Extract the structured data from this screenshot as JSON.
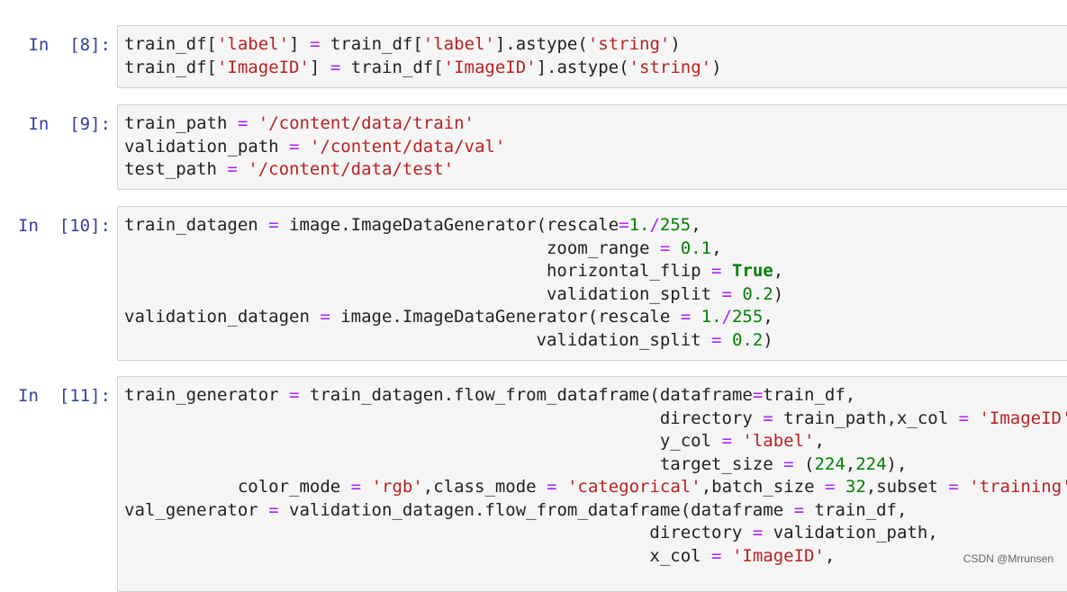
{
  "colors": {
    "prompt": "#303f9f",
    "default": "#212121",
    "operator": "#aa22ff",
    "string": "#ba2121",
    "number": "#008000",
    "keyword": "#008000",
    "cell_background": "#f5f5f5",
    "cell_border": "#cfcfcf"
  },
  "watermark": "CSDN @Mrrunsen",
  "cells": [
    {
      "prompt": "In  [8]:",
      "lines": [
        [
          [
            "var",
            "train_df"
          ],
          [
            "p",
            "["
          ],
          [
            "s",
            "'label'"
          ],
          [
            "p",
            "] "
          ],
          [
            "o",
            "="
          ],
          [
            "p",
            " train_df["
          ],
          [
            "s",
            "'label'"
          ],
          [
            "p",
            "].astype("
          ],
          [
            "s",
            "'string'"
          ],
          [
            "p",
            ")"
          ]
        ],
        [
          [
            "var",
            "train_df"
          ],
          [
            "p",
            "["
          ],
          [
            "s",
            "'ImageID'"
          ],
          [
            "p",
            "] "
          ],
          [
            "o",
            "="
          ],
          [
            "p",
            " train_df["
          ],
          [
            "s",
            "'ImageID'"
          ],
          [
            "p",
            "].astype("
          ],
          [
            "s",
            "'string'"
          ],
          [
            "p",
            ")"
          ]
        ]
      ]
    },
    {
      "prompt": "In  [9]:",
      "lines": [
        [
          [
            "var",
            "train_path "
          ],
          [
            "o",
            "="
          ],
          [
            "p",
            " "
          ],
          [
            "s",
            "'/content/data/train'"
          ]
        ],
        [
          [
            "var",
            "validation_path "
          ],
          [
            "o",
            "="
          ],
          [
            "p",
            " "
          ],
          [
            "s",
            "'/content/data/val'"
          ]
        ],
        [
          [
            "var",
            "test_path "
          ],
          [
            "o",
            "="
          ],
          [
            "p",
            " "
          ],
          [
            "s",
            "'/content/data/test'"
          ]
        ]
      ]
    },
    {
      "prompt": "In  [10]:",
      "lines": [
        [
          [
            "var",
            "train_datagen "
          ],
          [
            "o",
            "="
          ],
          [
            "p",
            " image.ImageDataGenerator(rescale"
          ],
          [
            "o",
            "="
          ],
          [
            "n",
            "1."
          ],
          [
            "o",
            "/"
          ],
          [
            "n",
            "255"
          ],
          [
            "p",
            ","
          ]
        ],
        [
          [
            "p",
            "                                         zoom_range "
          ],
          [
            "o",
            "="
          ],
          [
            "p",
            " "
          ],
          [
            "n",
            "0.1"
          ],
          [
            "p",
            ","
          ]
        ],
        [
          [
            "p",
            "                                         horizontal_flip "
          ],
          [
            "o",
            "="
          ],
          [
            "p",
            " "
          ],
          [
            "k",
            "True"
          ],
          [
            "p",
            ","
          ]
        ],
        [
          [
            "p",
            "                                         validation_split "
          ],
          [
            "o",
            "="
          ],
          [
            "p",
            " "
          ],
          [
            "n",
            "0.2"
          ],
          [
            "p",
            ")"
          ]
        ],
        [
          [
            "var",
            "validation_datagen "
          ],
          [
            "o",
            "="
          ],
          [
            "p",
            " image.ImageDataGenerator(rescale "
          ],
          [
            "o",
            "="
          ],
          [
            "p",
            " "
          ],
          [
            "n",
            "1."
          ],
          [
            "o",
            "/"
          ],
          [
            "n",
            "255"
          ],
          [
            "p",
            ","
          ]
        ],
        [
          [
            "p",
            "                                        validation_split "
          ],
          [
            "o",
            "="
          ],
          [
            "p",
            " "
          ],
          [
            "n",
            "0.2"
          ],
          [
            "p",
            ")"
          ]
        ]
      ]
    },
    {
      "prompt": "In  [11]:",
      "lines": [
        [
          [
            "var",
            "train_generator "
          ],
          [
            "o",
            "="
          ],
          [
            "p",
            " train_datagen.flow_from_dataframe(dataframe"
          ],
          [
            "o",
            "="
          ],
          [
            "p",
            "train_df,"
          ]
        ],
        [
          [
            "p",
            "                                                    directory "
          ],
          [
            "o",
            "="
          ],
          [
            "p",
            " train_path,x_col "
          ],
          [
            "o",
            "="
          ],
          [
            "p",
            " "
          ],
          [
            "s",
            "'ImageID'"
          ],
          [
            "p",
            ","
          ]
        ],
        [
          [
            "p",
            "                                                    y_col "
          ],
          [
            "o",
            "="
          ],
          [
            "p",
            " "
          ],
          [
            "s",
            "'label'"
          ],
          [
            "p",
            ","
          ]
        ],
        [
          [
            "p",
            "                                                    target_size "
          ],
          [
            "o",
            "="
          ],
          [
            "p",
            " ("
          ],
          [
            "n",
            "224"
          ],
          [
            "p",
            ","
          ],
          [
            "n",
            "224"
          ],
          [
            "p",
            "),"
          ]
        ],
        [
          [
            "p",
            "           color_mode "
          ],
          [
            "o",
            "="
          ],
          [
            "p",
            " "
          ],
          [
            "s",
            "'rgb'"
          ],
          [
            "p",
            ",class_mode "
          ],
          [
            "o",
            "="
          ],
          [
            "p",
            " "
          ],
          [
            "s",
            "'categorical'"
          ],
          [
            "p",
            ",batch_size "
          ],
          [
            "o",
            "="
          ],
          [
            "p",
            " "
          ],
          [
            "n",
            "32"
          ],
          [
            "p",
            ",subset "
          ],
          [
            "o",
            "="
          ],
          [
            "p",
            " "
          ],
          [
            "s",
            "'training'"
          ],
          [
            "p",
            ")"
          ]
        ],
        [
          [
            "var",
            "val_generator "
          ],
          [
            "o",
            "="
          ],
          [
            "p",
            " validation_datagen.flow_from_dataframe(dataframe "
          ],
          [
            "o",
            "="
          ],
          [
            "p",
            " train_df,"
          ]
        ],
        [
          [
            "p",
            "                                                   directory "
          ],
          [
            "o",
            "="
          ],
          [
            "p",
            " validation_path,"
          ]
        ],
        [
          [
            "p",
            "                                                   x_col "
          ],
          [
            "o",
            "="
          ],
          [
            "p",
            " "
          ],
          [
            "s",
            "'ImageID'"
          ],
          [
            "p",
            ","
          ]
        ]
      ]
    }
  ]
}
